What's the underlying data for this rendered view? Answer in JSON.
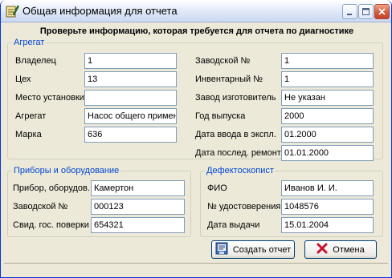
{
  "window": {
    "title": "Общая информация для отчета"
  },
  "heading": "Проверьте информацию, которая требуется для отчета по диагностике",
  "aggregate": {
    "legend": "Агрегат",
    "left": [
      {
        "label": "Владелец",
        "value": "1"
      },
      {
        "label": "Цех",
        "value": "13"
      },
      {
        "label": "Место установки",
        "value": ""
      },
      {
        "label": "Агрегат",
        "value": "Насос общего примене"
      },
      {
        "label": "Марка",
        "value": "636"
      }
    ],
    "right": [
      {
        "label": "Заводской №",
        "value": "1"
      },
      {
        "label": "Инвентарный №",
        "value": "1"
      },
      {
        "label": "Завод изготовитель",
        "value": "Не указан"
      },
      {
        "label": "Год выпуска",
        "value": "2000"
      },
      {
        "label": "Дата ввода в экспл.",
        "value": "01.2000"
      },
      {
        "label": "Дата послед. ремонта",
        "value": "01.01.2000"
      }
    ]
  },
  "devices": {
    "legend": "Приборы и оборудование",
    "rows": [
      {
        "label": "Прибор, оборудов.",
        "value": "Камертон"
      },
      {
        "label": "Заводской №",
        "value": "000123"
      },
      {
        "label": "Свид. гос. поверки",
        "value": "654321"
      }
    ]
  },
  "inspector": {
    "legend": "Дефектоскопист",
    "rows": [
      {
        "label": "ФИО",
        "value": "Иванов И. И."
      },
      {
        "label": "№ удостоверения",
        "value": "1048576"
      },
      {
        "label": "Дата выдачи",
        "value": "15.01.2004"
      }
    ]
  },
  "buttons": {
    "create_label": "Создать отчет",
    "cancel_label": "Отмена"
  },
  "icons": {
    "app": "notepad-pen-icon",
    "create": "report-document-icon",
    "cancel": "red-x-icon"
  },
  "colors": {
    "legend": "#0046d5",
    "close_button": "#d55a3a",
    "cancel_x": "#c8102e"
  }
}
